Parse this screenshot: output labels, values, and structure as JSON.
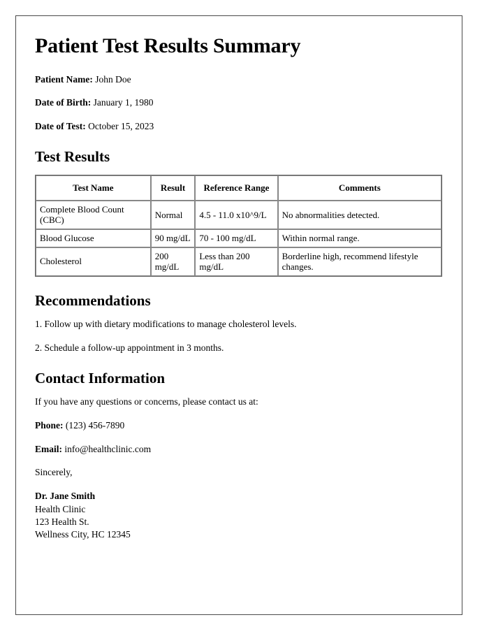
{
  "document": {
    "title": "Patient Test Results Summary",
    "patient": {
      "name_label": "Patient Name:",
      "name_value": "John Doe",
      "dob_label": "Date of Birth:",
      "dob_value": "January 1, 1980",
      "test_date_label": "Date of Test:",
      "test_date_value": "October 15, 2023"
    },
    "test_results": {
      "heading": "Test Results",
      "columns": [
        "Test Name",
        "Result",
        "Reference Range",
        "Comments"
      ],
      "rows": [
        {
          "test_name": "Complete Blood Count (CBC)",
          "result": "Normal",
          "reference_range": "4.5 - 11.0 x10^9/L",
          "comments": "No abnormalities detected."
        },
        {
          "test_name": "Blood Glucose",
          "result": "90 mg/dL",
          "reference_range": "70 - 100 mg/dL",
          "comments": "Within normal range."
        },
        {
          "test_name": "Cholesterol",
          "result": "200 mg/dL",
          "reference_range": "Less than 200 mg/dL",
          "comments": "Borderline high, recommend lifestyle changes."
        }
      ]
    },
    "recommendations": {
      "heading": "Recommendations",
      "items": [
        "1. Follow up with dietary modifications to manage cholesterol levels.",
        "2. Schedule a follow-up appointment in 3 months."
      ]
    },
    "contact": {
      "heading": "Contact Information",
      "intro": "If you have any questions or concerns, please contact us at:",
      "phone_label": "Phone:",
      "phone_value": "(123) 456-7890",
      "email_label": "Email:",
      "email_value": "info@healthclinic.com"
    },
    "signature": {
      "closing": "Sincerely,",
      "name": "Dr. Jane Smith",
      "organization": "Health Clinic",
      "street": "123 Health St.",
      "city_state_zip": "Wellness City, HC 12345"
    }
  }
}
